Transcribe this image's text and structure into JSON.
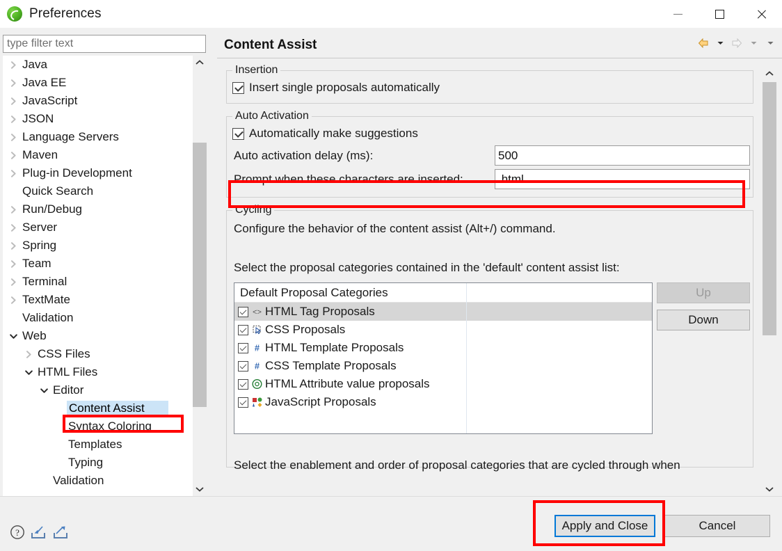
{
  "window": {
    "title": "Preferences",
    "app_icon": "eclipse-icon",
    "minimize_label": "Minimize",
    "maximize_label": "Maximize",
    "close_label": "Close"
  },
  "filter": {
    "placeholder": "type filter text",
    "value": ""
  },
  "tree": {
    "items": [
      {
        "label": "Java",
        "indent": 0,
        "state": "collapsed",
        "selected": false
      },
      {
        "label": "Java EE",
        "indent": 0,
        "state": "collapsed",
        "selected": false
      },
      {
        "label": "JavaScript",
        "indent": 0,
        "state": "collapsed",
        "selected": false
      },
      {
        "label": "JSON",
        "indent": 0,
        "state": "collapsed",
        "selected": false
      },
      {
        "label": "Language Servers",
        "indent": 0,
        "state": "collapsed",
        "selected": false
      },
      {
        "label": "Maven",
        "indent": 0,
        "state": "collapsed",
        "selected": false
      },
      {
        "label": "Plug-in Development",
        "indent": 0,
        "state": "collapsed",
        "selected": false
      },
      {
        "label": "Quick Search",
        "indent": 0,
        "state": "leaf",
        "selected": false
      },
      {
        "label": "Run/Debug",
        "indent": 0,
        "state": "collapsed",
        "selected": false
      },
      {
        "label": "Server",
        "indent": 0,
        "state": "collapsed",
        "selected": false
      },
      {
        "label": "Spring",
        "indent": 0,
        "state": "collapsed",
        "selected": false
      },
      {
        "label": "Team",
        "indent": 0,
        "state": "collapsed",
        "selected": false
      },
      {
        "label": "Terminal",
        "indent": 0,
        "state": "collapsed",
        "selected": false
      },
      {
        "label": "TextMate",
        "indent": 0,
        "state": "collapsed",
        "selected": false
      },
      {
        "label": "Validation",
        "indent": 0,
        "state": "leaf",
        "selected": false
      },
      {
        "label": "Web",
        "indent": 0,
        "state": "expanded",
        "selected": false
      },
      {
        "label": "CSS Files",
        "indent": 1,
        "state": "collapsed",
        "selected": false
      },
      {
        "label": "HTML Files",
        "indent": 1,
        "state": "expanded",
        "selected": false
      },
      {
        "label": "Editor",
        "indent": 2,
        "state": "expanded",
        "selected": false
      },
      {
        "label": "Content Assist",
        "indent": 3,
        "state": "leaf",
        "selected": true
      },
      {
        "label": "Syntax Coloring",
        "indent": 3,
        "state": "leaf",
        "selected": false
      },
      {
        "label": "Templates",
        "indent": 3,
        "state": "leaf",
        "selected": false
      },
      {
        "label": "Typing",
        "indent": 3,
        "state": "leaf",
        "selected": false
      },
      {
        "label": "Validation",
        "indent": 2,
        "state": "leaf",
        "selected": false
      }
    ]
  },
  "content": {
    "title": "Content Assist",
    "nav": {
      "back_icon": "back-arrow-icon",
      "back_menu_icon": "chevron-down-icon",
      "forward_icon": "forward-arrow-icon",
      "forward_menu_icon": "chevron-down-icon",
      "overflow_icon": "chevron-down-icon"
    },
    "insertion": {
      "group_title": "Insertion",
      "insert_single_label": "Insert single proposals automatically",
      "insert_single_checked": true
    },
    "auto_activation": {
      "group_title": "Auto Activation",
      "auto_suggest_label": "Automatically make suggestions",
      "auto_suggest_checked": true,
      "delay_label": "Auto activation delay (ms):",
      "delay_value": "500",
      "prompt_label": "Prompt when these characters are inserted:",
      "prompt_value": ".html"
    },
    "cycling": {
      "group_title": "Cycling",
      "description": "Configure the behavior of the content assist (Alt+/) command.",
      "select_label": "Select the proposal categories contained in the 'default' content assist list:",
      "table_header": "Default Proposal Categories",
      "rows": [
        {
          "label": "HTML Tag Proposals",
          "checked": true,
          "icon": "html-tag-icon",
          "glyph": "<>",
          "selected": true
        },
        {
          "label": "CSS Proposals",
          "checked": true,
          "icon": "css-cursor-icon",
          "glyph": "⬚",
          "selected": false
        },
        {
          "label": "HTML Template Proposals",
          "checked": true,
          "icon": "hash-icon",
          "glyph": "#",
          "selected": false
        },
        {
          "label": "CSS Template Proposals",
          "checked": true,
          "icon": "hash-icon",
          "glyph": "#",
          "selected": false
        },
        {
          "label": "HTML Attribute value proposals",
          "checked": true,
          "icon": "at-circle-icon",
          "glyph": "ⓐ",
          "selected": false
        },
        {
          "label": "JavaScript Proposals",
          "checked": true,
          "icon": "javascript-shapes-icon",
          "glyph": "⁙",
          "selected": false
        }
      ],
      "up_label": "Up",
      "up_enabled": false,
      "down_label": "Down",
      "down_enabled": true,
      "enablement_text": "Select the enablement and order of proposal categories that are cycled through when"
    }
  },
  "bottom": {
    "help_icon": "help-question-icon",
    "import_icon": "import-icon",
    "export_icon": "export-icon",
    "apply_and_close_label": "Apply and Close",
    "cancel_label": "Cancel"
  },
  "colors": {
    "highlight": "#ff0000",
    "focus": "#0078d7",
    "selection": "#cce4f7",
    "row_selection": "#d6d6d6"
  }
}
